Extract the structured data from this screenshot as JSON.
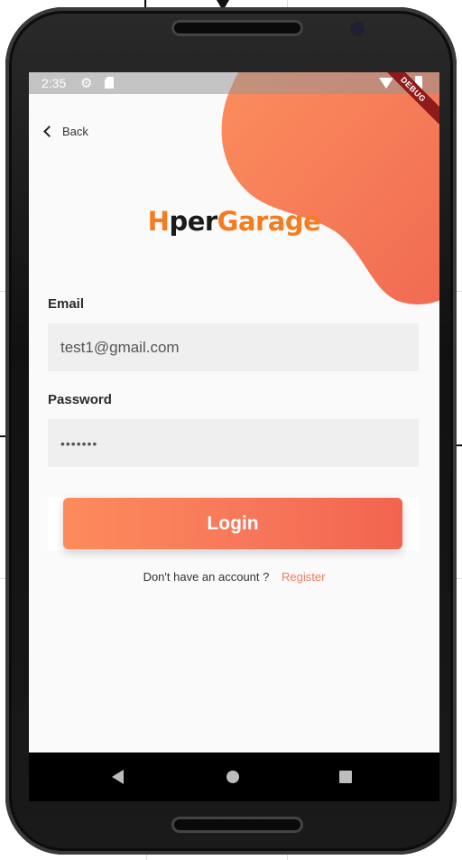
{
  "status_bar": {
    "time": "2:35",
    "icons": [
      "gear-icon",
      "sd-card-icon",
      "wifi-icon",
      "battery-icon"
    ]
  },
  "debug_banner": "DEBUG",
  "back": {
    "label": "Back"
  },
  "logo": {
    "part1": "H",
    "part2": "per",
    "part3": "Garage"
  },
  "form": {
    "email_label": "Email",
    "email_value": "test1@gmail.com",
    "password_label": "Password",
    "password_value": "•••••••"
  },
  "login_button": "Login",
  "register": {
    "prompt": "Don't have an account ?",
    "link": "Register"
  },
  "colors": {
    "accent": "#f7775a",
    "logo_orange": "#f57c1f",
    "field_bg": "#efefef"
  },
  "nav_bar": {
    "icons": [
      "back-triangle-icon",
      "home-circle-icon",
      "recent-square-icon"
    ]
  }
}
